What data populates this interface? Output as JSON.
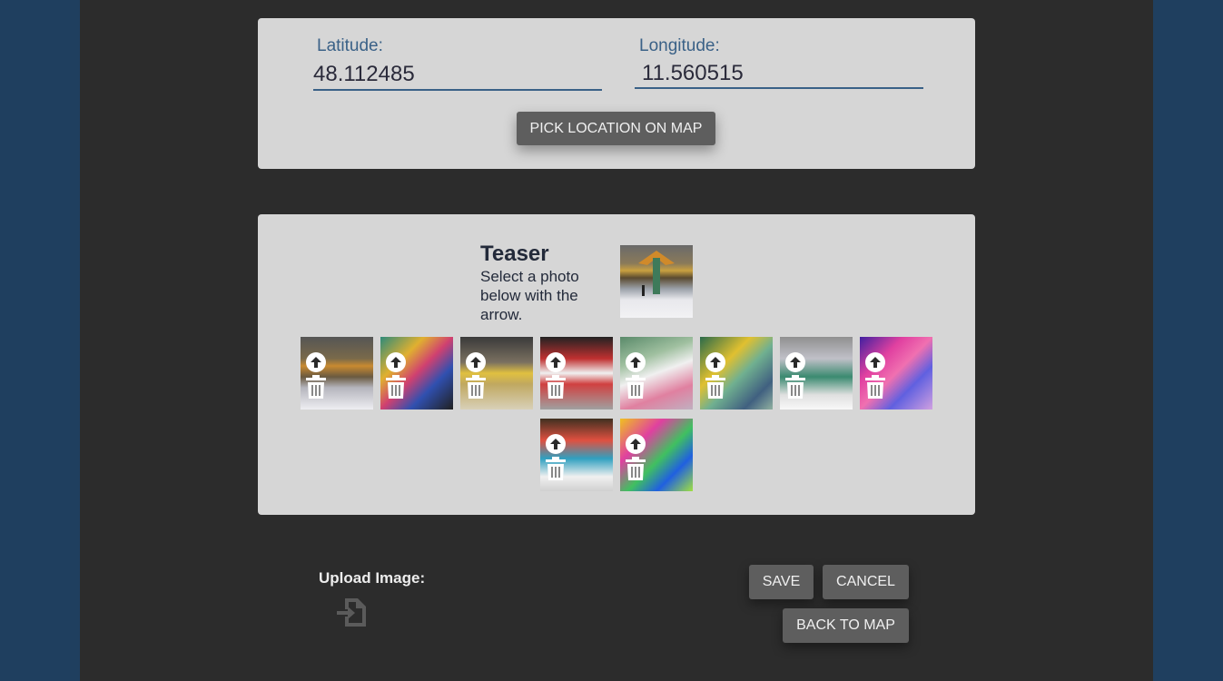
{
  "location": {
    "latitude_label": "Latitude:",
    "latitude_value": "48.112485",
    "longitude_label": "Longitude:",
    "longitude_value": "11.560515",
    "pick_button": "PICK LOCATION ON MAP"
  },
  "photos": {
    "teaser_title": "Teaser",
    "teaser_description": "Select a photo below with the arrow.",
    "thumbnails": [
      {
        "id": "photo-1"
      },
      {
        "id": "photo-2"
      },
      {
        "id": "photo-3"
      },
      {
        "id": "photo-4"
      },
      {
        "id": "photo-5"
      },
      {
        "id": "photo-6"
      },
      {
        "id": "photo-7"
      },
      {
        "id": "photo-8"
      },
      {
        "id": "photo-9"
      },
      {
        "id": "photo-10"
      }
    ]
  },
  "upload": {
    "label": "Upload Image:",
    "icon": "file-import-icon"
  },
  "actions": {
    "save": "SAVE",
    "cancel": "CANCEL",
    "back": "BACK TO MAP"
  },
  "colors": {
    "page_bg": "#1f3f5f",
    "panel_bg": "#2c2c2c",
    "card_bg": "#d6d6d6",
    "accent": "#3a6187",
    "button_bg": "#5e5e5e"
  }
}
